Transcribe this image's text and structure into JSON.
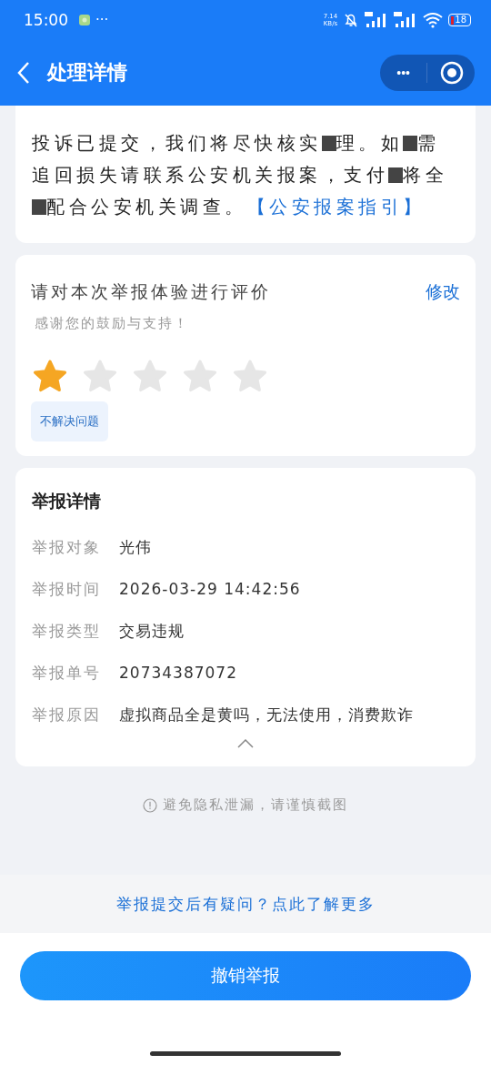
{
  "status_bar": {
    "time": "15:00",
    "more": "···",
    "net_speed": "7.14",
    "net_unit": "KB/s",
    "battery": "18"
  },
  "nav": {
    "title": "处理详情",
    "more": "•••"
  },
  "notice": {
    "segments": [
      {
        "kind": "text",
        "text": "投诉已提交，我们将尽快核实"
      },
      {
        "kind": "redaction"
      },
      {
        "kind": "text",
        "text": "理。如"
      },
      {
        "kind": "redaction"
      },
      {
        "kind": "text",
        "text": "需追回损失请联系公安机关报案，支付"
      },
      {
        "kind": "redaction"
      },
      {
        "kind": "text",
        "text": "将全"
      },
      {
        "kind": "redaction"
      },
      {
        "kind": "text",
        "text": "配合公安机关调查。"
      }
    ],
    "link": "【公安报案指引】"
  },
  "rating": {
    "title": "请对本次举报体验进行评价",
    "edit": "修改",
    "subtitle": "感谢您的鼓励与支持！",
    "stars": 1,
    "tags": [
      "不解决问题"
    ]
  },
  "details": {
    "title": "举报详情",
    "rows": [
      {
        "label": "举报对象",
        "value": "光伟"
      },
      {
        "label": "举报时间",
        "value": "2026-03-29 14:42:56"
      },
      {
        "label": "举报类型",
        "value": "交易违规"
      },
      {
        "label": "举报单号",
        "value": "20734387072"
      },
      {
        "label": "举报原因",
        "value": "虚拟商品全是黄吗，无法使用，消费欺诈"
      }
    ]
  },
  "privacy": "避免隐私泄漏，请谨慎截图",
  "help_link": "举报提交后有疑问？点此了解更多",
  "button": "撤销举报"
}
